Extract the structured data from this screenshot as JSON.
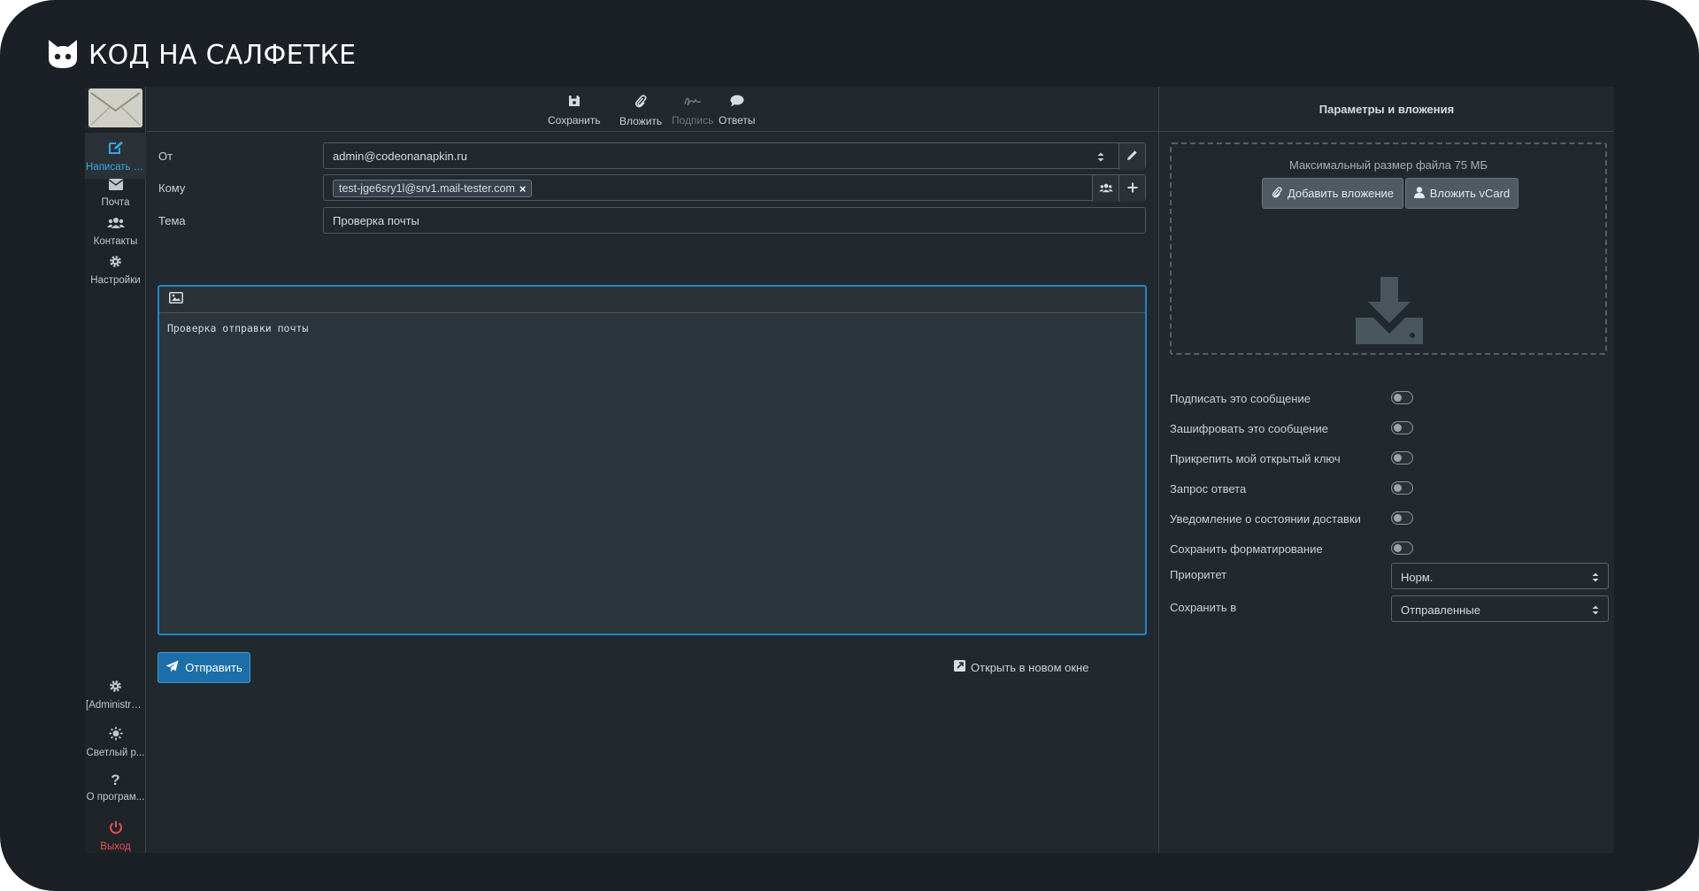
{
  "brand": {
    "title": "КОД НА САЛФЕТКЕ",
    "logo_icon": "cat-face-icon"
  },
  "sidebar": {
    "top": [
      {
        "id": "compose",
        "label": "Написать с...",
        "icon": "edit-icon",
        "active": true
      },
      {
        "id": "mail",
        "label": "Почта",
        "icon": "envelope-icon"
      },
      {
        "id": "contacts",
        "label": "Контакты",
        "icon": "users-icon"
      },
      {
        "id": "settings",
        "label": "Настройки",
        "icon": "gear-icon"
      }
    ],
    "bottom": [
      {
        "id": "admin",
        "label": "[Administra...",
        "icon": "gear-icon"
      },
      {
        "id": "theme",
        "label": "Светлый р...",
        "icon": "sun-icon"
      },
      {
        "id": "about",
        "label": "О програм...",
        "icon": "question-icon"
      },
      {
        "id": "logout",
        "label": "Выход",
        "icon": "power-icon"
      }
    ]
  },
  "toolbar": {
    "save": "Сохранить",
    "attach": "Вложить",
    "signature": "Подпись",
    "responses": "Ответы"
  },
  "compose": {
    "from_label": "От",
    "from_value": "admin@codeonanapkin.ru",
    "to_label": "Кому",
    "to_recipient": "test-jge6sry1l@srv1.mail-tester.com",
    "subject_label": "Тема",
    "subject_value": "Проверка почты",
    "body": "Проверка отправки почты",
    "send": "Отправить",
    "open_new_window": "Открыть в новом окне"
  },
  "options": {
    "title": "Параметры и вложения",
    "max_size": "Максимальный размер файла 75 МБ",
    "add_attachment": "Добавить вложение",
    "attach_vcard": "Вложить vCard",
    "toggles": [
      "Подписать это сообщение",
      "Зашифровать это сообщение",
      "Прикрепить мой открытый ключ",
      "Запрос ответа",
      "Уведомление о состоянии доставки",
      "Сохранить форматирование"
    ],
    "priority_label": "Приоритет",
    "priority_value": "Норм.",
    "save_in_label": "Сохранить в",
    "save_in_value": "Отправленные"
  },
  "colors": {
    "accent": "#37a8e6",
    "send_button": "#1c6fa8",
    "logout": "#e85151",
    "background": "#22292e"
  }
}
